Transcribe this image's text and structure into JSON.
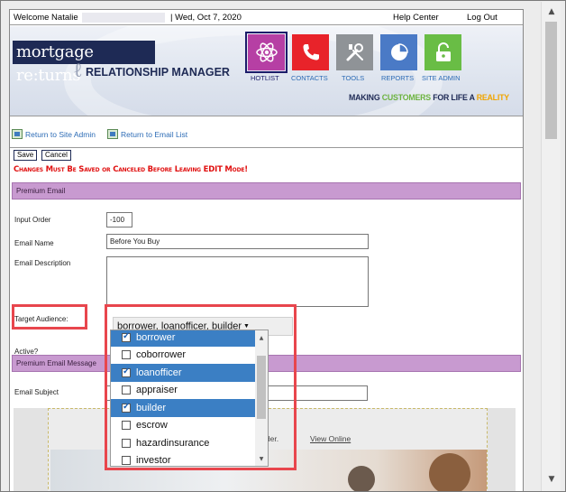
{
  "topbar": {
    "welcome": "Welcome Natalie",
    "date": "| Wed, Oct 7, 2020",
    "help": "Help Center",
    "logout": "Log Out"
  },
  "brand": {
    "logo": "mortgage re:turns",
    "subtitle": "RELATIONSHIP MANAGER",
    "tagline_parts": [
      "MAKING ",
      "CUSTOMERS",
      " FOR LIFE A ",
      "REALITY"
    ]
  },
  "nav": [
    {
      "label": "HOTLIST",
      "color": "#b63fa4",
      "icon": "atom-icon"
    },
    {
      "label": "CONTACTS",
      "color": "#e8232a",
      "icon": "phone-icon"
    },
    {
      "label": "TOOLS",
      "color": "#8f9397",
      "icon": "tools-icon"
    },
    {
      "label": "REPORTS",
      "color": "#4a7ac6",
      "icon": "pie-chart-icon"
    },
    {
      "label": "SITE ADMIN",
      "color": "#69bd45",
      "icon": "lock-icon"
    }
  ],
  "crumbs": {
    "site_admin": "Return to Site Admin",
    "email_list": "Return to Email List"
  },
  "form": {
    "save": "Save",
    "cancel": "Cancel",
    "warning": "Changes Must Be Saved or Canceled Before Leaving EDIT Mode!",
    "section_premium": "Premium Email",
    "input_order_label": "Input Order",
    "input_order_value": "-100",
    "email_name_label": "Email Name",
    "email_name_value": "Before You Buy",
    "email_desc_label": "Email Description",
    "email_desc_value": "",
    "target_label": "Target Audience:",
    "target_value": "borrower, loanofficer, builder",
    "active_label": "Active?",
    "section_message": "Premium Email Message",
    "subject_label": "Email Subject",
    "subject_value": ""
  },
  "dropdown": {
    "options": [
      {
        "label": "borrower",
        "checked": true
      },
      {
        "label": "coborrower",
        "checked": false
      },
      {
        "label": "loanofficer",
        "checked": true
      },
      {
        "label": "appraiser",
        "checked": false
      },
      {
        "label": "builder",
        "checked": true
      },
      {
        "label": "escrow",
        "checked": false
      },
      {
        "label": "hazardinsurance",
        "checked": false
      },
      {
        "label": "investor",
        "checked": false
      }
    ]
  },
  "preview": {
    "line": "o consider.",
    "view_online": "View Online"
  }
}
